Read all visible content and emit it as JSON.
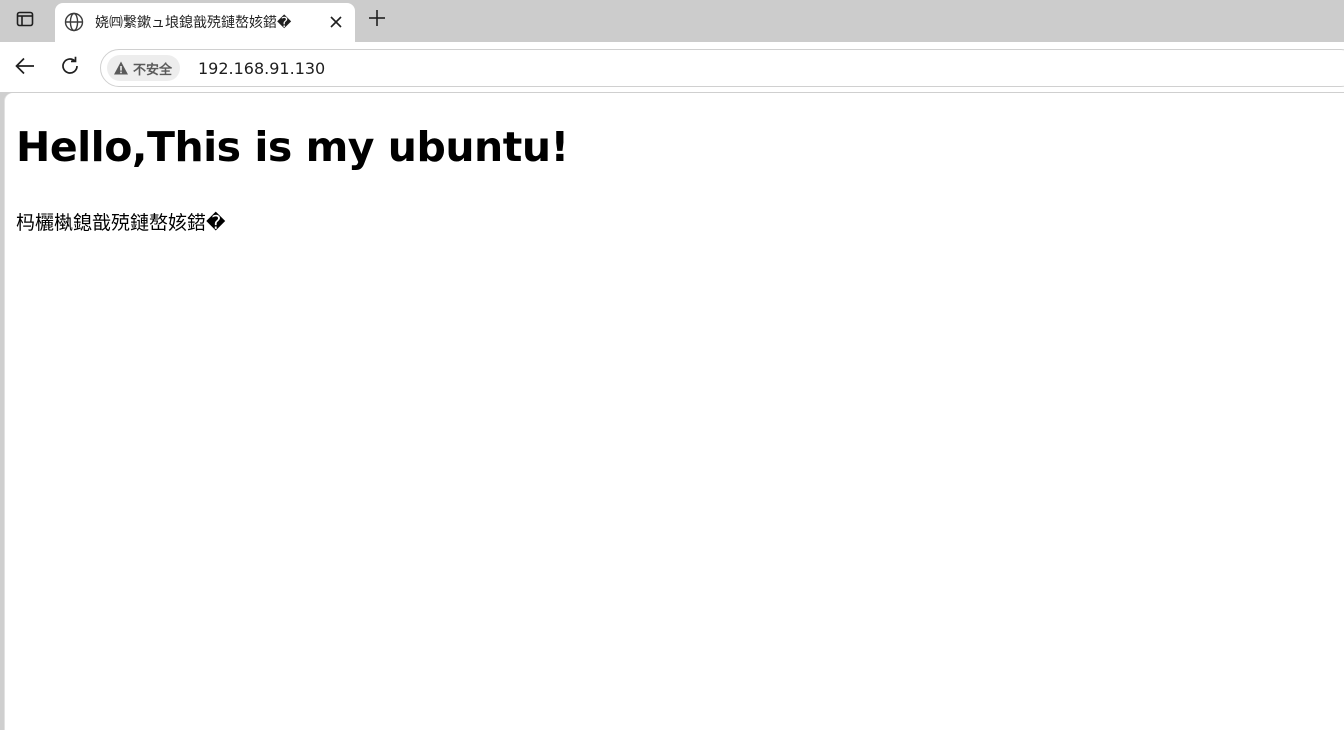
{
  "browser": {
    "tab": {
      "title": "娆㈣繋鏉ュ埌鎴戠殑鏈嶅姟鍣�",
      "favicon": "globe-icon"
    },
    "icons": {
      "tab_actions": "tab-actions-icon",
      "close_tab": "close-icon",
      "new_tab": "plus-icon",
      "back": "back-arrow-icon",
      "reload": "reload-icon",
      "warning": "warning-triangle-icon"
    },
    "omnibox": {
      "security_label": "不安全",
      "url": "192.168.91.130"
    }
  },
  "page": {
    "heading": "Hello,This is my ubuntu!",
    "paragraph": "杩欐槸鎴戠殑鏈嶅姟鍣�"
  },
  "colors": {
    "tabstrip_bg": "#cccccc",
    "toolbar_bg": "#ffffff",
    "security_chip_bg": "#ededed",
    "text": "#1f1f1f"
  }
}
